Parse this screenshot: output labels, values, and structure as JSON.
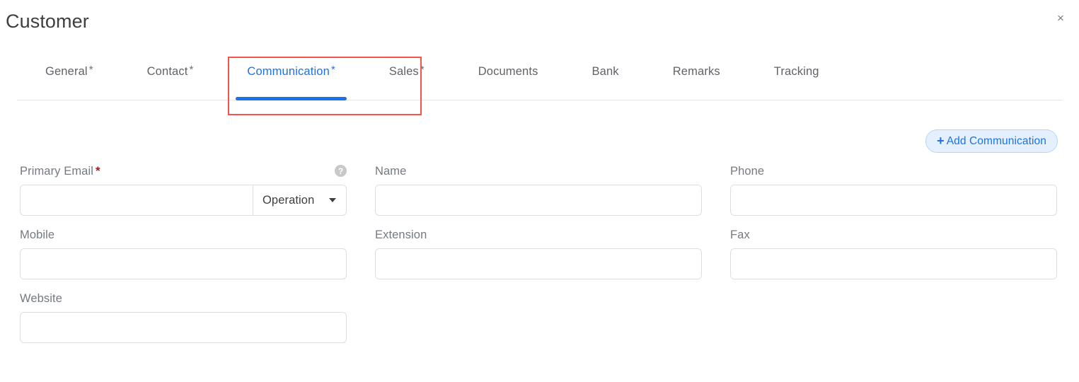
{
  "header": {
    "title": "Customer",
    "close_label": "×"
  },
  "tabs": [
    {
      "label": "General",
      "required_marker": "*",
      "active": false
    },
    {
      "label": "Contact",
      "required_marker": "*",
      "active": false
    },
    {
      "label": "Communication",
      "required_marker": "*",
      "active": true
    },
    {
      "label": "Sales",
      "required_marker": "*",
      "active": false
    },
    {
      "label": "Documents",
      "required_marker": "",
      "active": false
    },
    {
      "label": "Bank",
      "required_marker": "",
      "active": false
    },
    {
      "label": "Remarks",
      "required_marker": "",
      "active": false
    },
    {
      "label": "Tracking",
      "required_marker": "",
      "active": false
    }
  ],
  "toolbar": {
    "add_communication_label": "Add Communication",
    "add_icon": "plus-icon"
  },
  "form": {
    "primary_email": {
      "label": "Primary Email",
      "required_marker": "*",
      "value": "",
      "placeholder": "",
      "help_icon": "help-circle-icon",
      "dropdown_value": "Operation"
    },
    "name": {
      "label": "Name",
      "value": "",
      "placeholder": ""
    },
    "phone": {
      "label": "Phone",
      "value": "",
      "placeholder": ""
    },
    "mobile": {
      "label": "Mobile",
      "value": "",
      "placeholder": ""
    },
    "extension": {
      "label": "Extension",
      "value": "",
      "placeholder": ""
    },
    "fax": {
      "label": "Fax",
      "value": "",
      "placeholder": ""
    },
    "website": {
      "label": "Website",
      "value": "",
      "placeholder": ""
    }
  },
  "colors": {
    "accent_blue": "#1a73e8",
    "annotation_red": "#f4544c",
    "required_red": "#9e1b1b",
    "label_gray": "#747a80",
    "border_gray": "#dcdfe2"
  }
}
